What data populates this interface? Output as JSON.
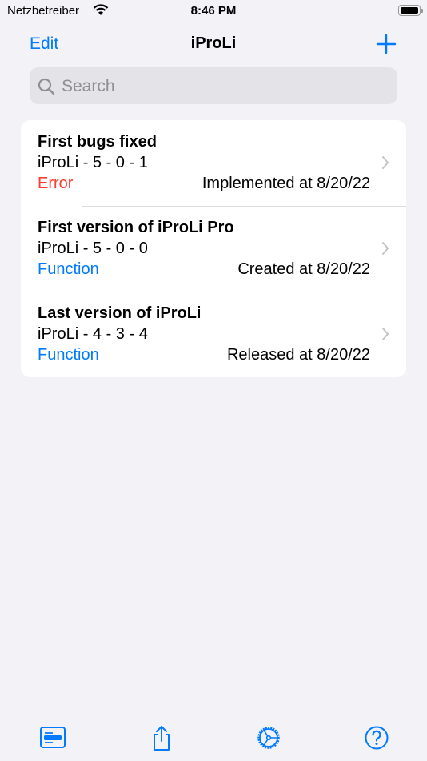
{
  "status_bar": {
    "carrier": "Netzbetreiber",
    "time": "8:46 PM"
  },
  "nav": {
    "edit_label": "Edit",
    "title": "iProLi",
    "add_icon": "plus-icon"
  },
  "search": {
    "placeholder": "Search",
    "value": ""
  },
  "colors": {
    "accent": "#007aff",
    "error": "#ff3b30",
    "background": "#f2f2f7"
  },
  "items": [
    {
      "title": "First bugs fixed",
      "version": "iProLi - 5 - 0 - 1",
      "category": "Error",
      "category_color": "#ff3b30",
      "date": "Implemented at 8/20/22"
    },
    {
      "title": "First version of iProLi Pro",
      "version": "iProLi - 5 - 0 - 0",
      "category": "Function",
      "category_color": "#007aff",
      "date": "Created at 8/20/22"
    },
    {
      "title": "Last version of iProLi",
      "version": "iProLi - 4 - 3 - 4",
      "category": "Function",
      "category_color": "#007aff",
      "date": "Released at 8/20/22"
    }
  ],
  "toolbar": [
    {
      "icon": "list-card-icon"
    },
    {
      "icon": "share-icon"
    },
    {
      "icon": "settings-gear-icon"
    },
    {
      "icon": "help-icon"
    }
  ]
}
